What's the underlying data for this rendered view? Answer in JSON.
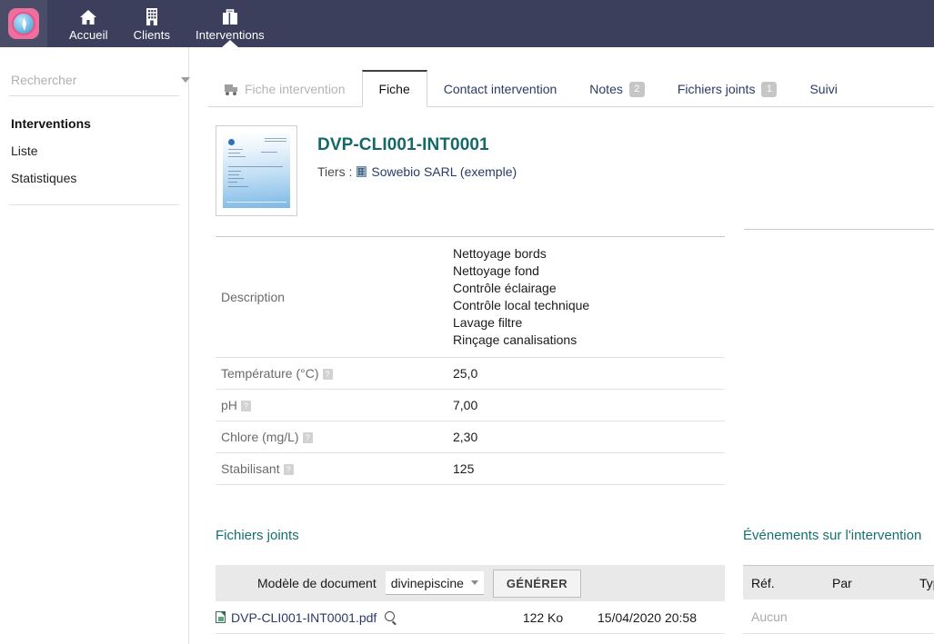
{
  "topnav": {
    "logo_name": "divinepiscine-logo",
    "items": [
      {
        "label": "Accueil",
        "icon": "home-icon",
        "active": false
      },
      {
        "label": "Clients",
        "icon": "building-icon",
        "active": false
      },
      {
        "label": "Interventions",
        "icon": "briefcase-icon",
        "active": true
      }
    ]
  },
  "sidebar": {
    "search": {
      "placeholder": "Rechercher",
      "value": ""
    },
    "title": "Interventions",
    "items": [
      {
        "label": "Liste"
      },
      {
        "label": "Statistiques"
      }
    ]
  },
  "tabs": [
    {
      "label": "Fiche intervention",
      "state": "disabled",
      "icon": "print-truck-icon",
      "badge": ""
    },
    {
      "label": "Fiche",
      "state": "active",
      "badge": ""
    },
    {
      "label": "Contact intervention",
      "state": "normal",
      "badge": ""
    },
    {
      "label": "Notes",
      "state": "normal",
      "badge": "2"
    },
    {
      "label": "Fichiers joints",
      "state": "normal",
      "badge": "1"
    },
    {
      "label": "Suivi",
      "state": "normal",
      "badge": ""
    }
  ],
  "record": {
    "reference": "DVP-CLI001-INT0001",
    "tiers_label": "Tiers :",
    "tiers_name": "Sowebio SARL (exemple)",
    "thumbnail_name": "document-preview-thumbnail"
  },
  "fields": [
    {
      "label": "Description",
      "help": false,
      "lines": [
        "Nettoyage bords",
        "Nettoyage fond",
        "Contrôle éclairage",
        "Contrôle local technique",
        "Lavage filtre",
        "Rinçage canalisations"
      ],
      "value": ""
    },
    {
      "label": "Température (°C)",
      "help": true,
      "value": "25,0",
      "lines": []
    },
    {
      "label": "pH",
      "help": true,
      "value": "7,00",
      "lines": []
    },
    {
      "label": "Chlore (mg/L)",
      "help": true,
      "value": "2,30",
      "lines": []
    },
    {
      "label": "Stabilisant",
      "help": true,
      "value": "125",
      "lines": []
    }
  ],
  "help_glyph": "?",
  "files_section": {
    "title": "Fichiers joints",
    "generate": {
      "label": "Modèle de document",
      "selected_option": "divinepiscine",
      "button_label": "GÉNÉRER"
    },
    "rows": [
      {
        "name": "DVP-CLI001-INT0001.pdf",
        "size": "122 Ko",
        "date": "15/04/2020 20:58"
      }
    ]
  },
  "events_section": {
    "title": "Événements sur l'intervention",
    "columns": {
      "c1": "Réf.",
      "c2": "Par",
      "c3": "Typ"
    },
    "empty_text": "Aucun"
  },
  "colors": {
    "nav_bg": "#3c3f5c",
    "title_teal": "#14686a",
    "link_navy": "#2b3a67",
    "badge_gray": "#c6c6c6",
    "header_row_gray": "#e9e9e9"
  }
}
